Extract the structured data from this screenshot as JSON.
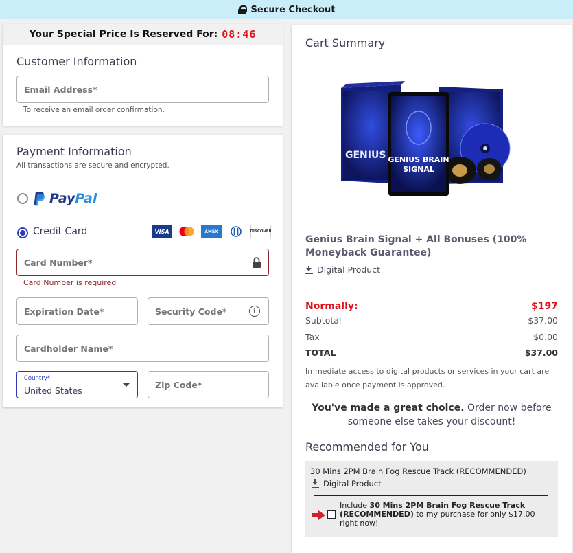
{
  "topbar": {
    "title": "Secure Checkout"
  },
  "timer": {
    "label": "Your Special Price Is Reserved For:",
    "value": "08:46"
  },
  "customer": {
    "title": "Customer Information",
    "email_placeholder": "Email Address*",
    "email_hint": "To receive an email order confirmation."
  },
  "payment": {
    "title": "Payment Information",
    "subtitle": "All transactions are secure and encrypted.",
    "paypal_pay": "Pay",
    "paypal_pal": "Pal",
    "credit_label": "Credit Card",
    "badges": {
      "visa": "VISA",
      "amex": "AMEX",
      "discover": "DISCOVER"
    },
    "card_number_placeholder": "Card Number*",
    "card_number_error": "Card Number is required",
    "expiration_placeholder": "Expiration Date*",
    "security_placeholder": "Security Code*",
    "cardholder_placeholder": "Cardholder Name*",
    "country_label": "Country*",
    "country_value": "United States",
    "zip_placeholder": "Zip Code*"
  },
  "summary": {
    "title": "Cart Summary",
    "product_box_title_1": "GENIUS BRAIN",
    "product_box_title_2": "SIGNAL",
    "product_box_side": "GENIUS",
    "product_name": "Genius Brain Signal + All Bonuses (100% Moneyback Guarantee)",
    "product_type": "Digital Product",
    "normally_label": "Normally:",
    "normally_value": "$197",
    "subtotal_label": "Subtotal",
    "subtotal_value": "$37.00",
    "tax_label": "Tax",
    "tax_value": "$0.00",
    "total_label": "TOTAL",
    "total_value": "$37.00",
    "note": "Immediate access to digital products or services in your cart are available once payment is approved.",
    "great_bold": "You've made a great choice.",
    "great_rest": " Order now before someone else takes your discount!"
  },
  "recommended": {
    "title": "Recommended for You",
    "item_name": "30 Mins 2PM Brain Fog Rescue Track (RECOMMENDED)",
    "item_type": "Digital Product",
    "include_prefix": "Include ",
    "include_bold": "30 Mins 2PM Brain Fog Rescue Track (RECOMMENDED)",
    "include_suffix": " to my purchase for only $17.00 right now!"
  },
  "colors": {
    "topbar_bg": "#c9eefa",
    "timer_red": "#e0121b",
    "accent_blue": "#2a3bb5",
    "error_red": "#8b2b2b"
  }
}
